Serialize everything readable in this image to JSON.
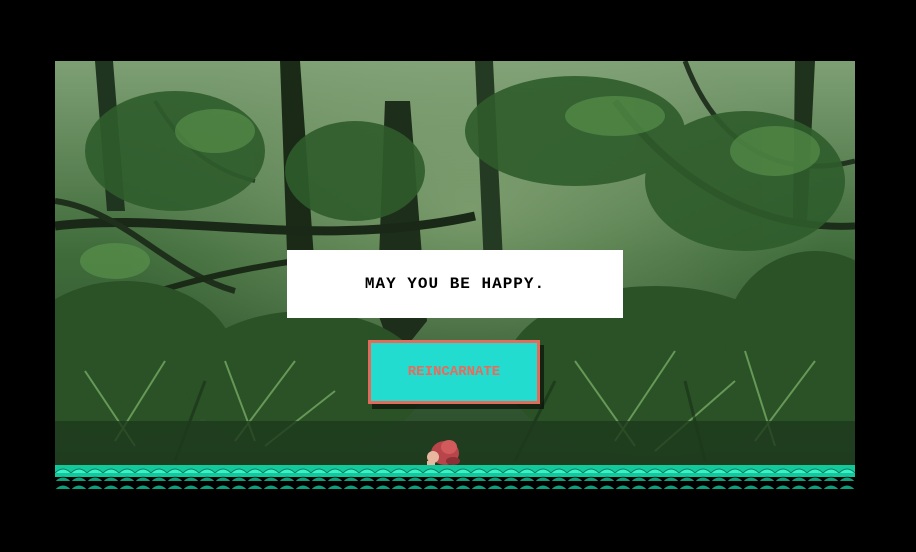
{
  "game": {
    "message": "MAY YOU BE HAPPY.",
    "button_label": "REINCARNATE"
  },
  "colors": {
    "background": "#000000",
    "message_box": "#ffffff",
    "message_text": "#000000",
    "button_fill": "#22dcd0",
    "button_border": "#e56a5a",
    "button_text": "#ea6a5c",
    "ground": "#19e0b0",
    "foliage_dark": "#1f3f1d",
    "foliage_light": "#6fa35a"
  },
  "icons": {
    "character": "curled-up-character-sprite",
    "ground": "scale-pattern-ground-tiles"
  }
}
